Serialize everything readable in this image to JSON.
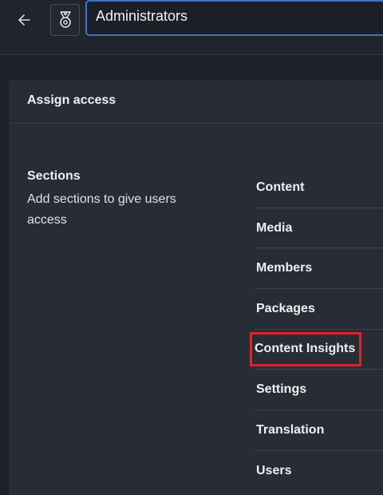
{
  "header": {
    "back_icon": "arrow-left-icon",
    "group_icon": "medal-icon",
    "group_name_value": "Administrators"
  },
  "panel": {
    "title": "Assign access",
    "sections": {
      "title": "Sections",
      "description": "Add sections to give users access",
      "items": [
        {
          "label": "Content"
        },
        {
          "label": "Media"
        },
        {
          "label": "Members"
        },
        {
          "label": "Packages"
        },
        {
          "label": "Content Insights",
          "highlighted": true
        },
        {
          "label": "Settings"
        },
        {
          "label": "Translation"
        },
        {
          "label": "Users"
        }
      ]
    }
  },
  "colors": {
    "highlight_box": "#e0232b",
    "input_focus_border": "#3f73c9"
  }
}
